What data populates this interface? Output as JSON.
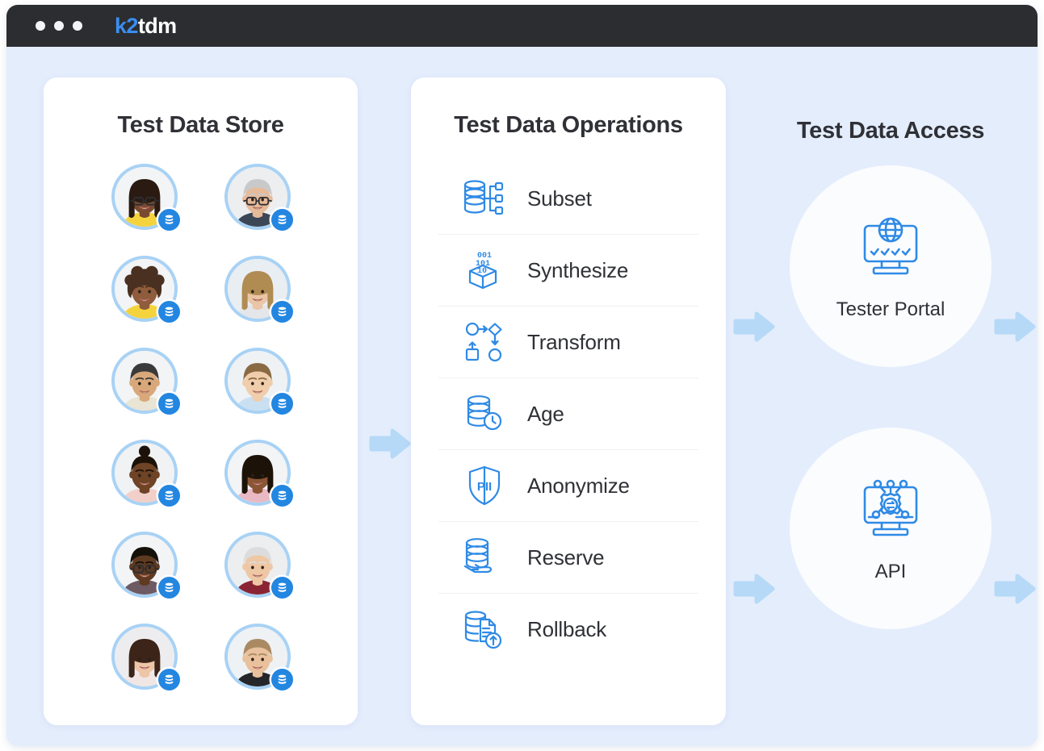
{
  "window": {
    "titlebar": {
      "dots_count": 3,
      "logo_primary": "k2",
      "logo_secondary": "tdm",
      "logo_primary_color": "#3b8ef0",
      "logo_secondary_color": "#ffffff",
      "background_color": "#2b2d31"
    },
    "background_color": "#e4edfc"
  },
  "store": {
    "title": "Test Data Store",
    "avatars": [
      {
        "id": "avatar-1",
        "badge_icon": "database-icon",
        "skin": "#7a4a30",
        "hair": "#2a1a12",
        "hair_style": "long",
        "shirt": "#f5d33c",
        "glasses": true,
        "bg": "#f2f4f6"
      },
      {
        "id": "avatar-2",
        "badge_icon": "database-icon",
        "skin": "#e6bb9a",
        "hair": "#c9c9c9",
        "hair_style": "short",
        "shirt": "#3b4656",
        "glasses": true,
        "bg": "#eceef0"
      },
      {
        "id": "avatar-3",
        "badge_icon": "database-icon",
        "skin": "#8f5c3c",
        "hair": "#4a3020",
        "hair_style": "curly",
        "shirt": "#f5d33c",
        "glasses": false,
        "bg": "#f2f4f6"
      },
      {
        "id": "avatar-4",
        "badge_icon": "database-icon",
        "skin": "#eac6a6",
        "hair": "#b08b52",
        "hair_style": "long",
        "shirt": "#e4e6ea",
        "glasses": false,
        "bg": "#e9eef2"
      },
      {
        "id": "avatar-5",
        "badge_icon": "database-icon",
        "skin": "#d9a87a",
        "hair": "#3a3a3a",
        "hair_style": "short",
        "shirt": "#e9e4d4",
        "glasses": false,
        "bg": "#f2f4f6"
      },
      {
        "id": "avatar-6",
        "badge_icon": "database-icon",
        "skin": "#f0cdab",
        "hair": "#8a6a43",
        "hair_style": "short",
        "shirt": "#c9e0f2",
        "glasses": false,
        "bg": "#eef2f5"
      },
      {
        "id": "avatar-7",
        "badge_icon": "database-icon",
        "skin": "#6e4326",
        "hair": "#1c1208",
        "hair_style": "bun",
        "shirt": "#f2cfc9",
        "glasses": false,
        "bg": "#f0f2f4"
      },
      {
        "id": "avatar-8",
        "badge_icon": "database-icon",
        "skin": "#8a5535",
        "hair": "#1c1208",
        "hair_style": "long",
        "shirt": "#e9b9c4",
        "glasses": false,
        "bg": "#f2f4f6"
      },
      {
        "id": "avatar-9",
        "badge_icon": "database-icon",
        "skin": "#5e3a20",
        "hair": "#14100a",
        "hair_style": "short",
        "shirt": "#6d5a62",
        "glasses": true,
        "bg": "#f2f4f6"
      },
      {
        "id": "avatar-10",
        "badge_icon": "database-icon",
        "skin": "#eec7a4",
        "hair": "#dcdcdc",
        "hair_style": "short",
        "shirt": "#8a2434",
        "glasses": false,
        "bg": "#eceef0"
      },
      {
        "id": "avatar-11",
        "badge_icon": "database-icon",
        "skin": "#edc6a8",
        "hair": "#3d2418",
        "hair_style": "long",
        "shirt": "#f0e6e4",
        "glasses": false,
        "bg": "#ededef"
      },
      {
        "id": "avatar-12",
        "badge_icon": "database-icon",
        "skin": "#e9c19c",
        "hair": "#a98a63",
        "hair_style": "short",
        "shirt": "#24262a",
        "glasses": false,
        "bg": "#eef2f5"
      }
    ]
  },
  "operations": {
    "title": "Test Data Operations",
    "items": [
      {
        "label": "Subset",
        "icon": "database-branch-icon"
      },
      {
        "label": "Synthesize",
        "icon": "binary-box-icon"
      },
      {
        "label": "Transform",
        "icon": "flow-transform-icon"
      },
      {
        "label": "Age",
        "icon": "database-clock-icon"
      },
      {
        "label": "Anonymize",
        "icon": "shield-pii-icon"
      },
      {
        "label": "Reserve",
        "icon": "database-hand-icon"
      },
      {
        "label": "Rollback",
        "icon": "database-restore-icon"
      }
    ]
  },
  "access": {
    "title": "Test Data Access",
    "items": [
      {
        "label": "Tester Portal",
        "icon": "monitor-globe-check-icon"
      },
      {
        "label": "API",
        "icon": "monitor-gear-api-icon"
      }
    ]
  },
  "arrows": {
    "color": "#b5d9f7",
    "items": [
      {
        "id": "arrow-store-ops",
        "direction": "right"
      },
      {
        "id": "arrow-ops-portal",
        "direction": "right"
      },
      {
        "id": "arrow-ops-api",
        "direction": "right"
      },
      {
        "id": "arrow-portal-out",
        "direction": "right"
      },
      {
        "id": "arrow-api-out",
        "direction": "right"
      }
    ]
  },
  "colors": {
    "accent_blue": "#2386e0",
    "icon_blue": "#2f8ae5",
    "text_dark": "#2f3136",
    "card_white": "#ffffff",
    "page_blue": "#e4edfc",
    "divider": "#eef0f2",
    "avatar_ring": "#a8d2f5",
    "circle_fill": "#fbfcfe"
  }
}
